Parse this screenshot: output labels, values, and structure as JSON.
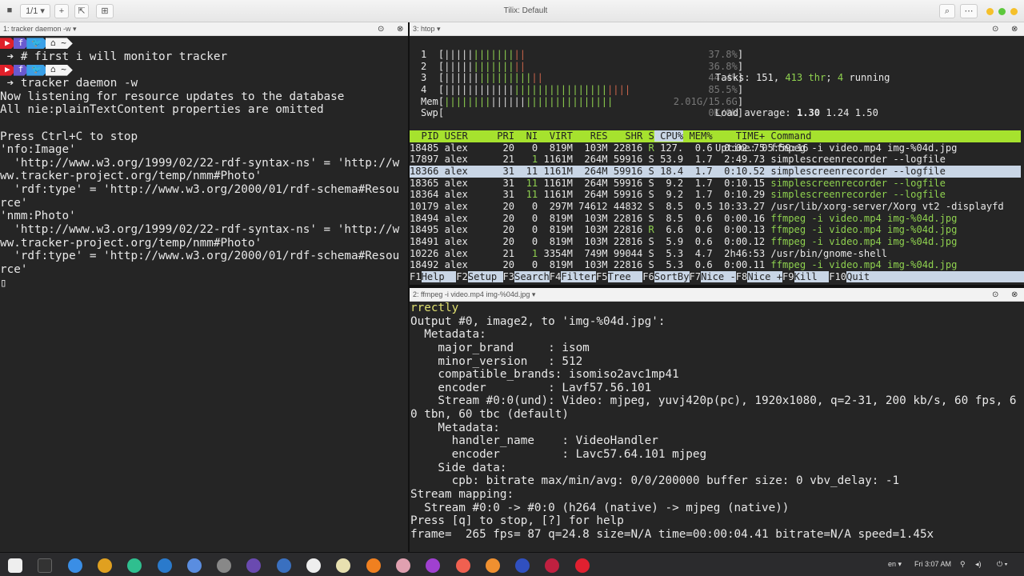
{
  "window": {
    "title": "Tilix: Default",
    "session": "1/1 ▾",
    "add": "+",
    "btn_detach": "⇱",
    "btn_new": "⊞",
    "search": "⌕",
    "menu": "⋯"
  },
  "panes": {
    "left": {
      "title": "1: tracker daemon -w ▾",
      "lines": [
        {
          "type": "prompt"
        },
        {
          "type": "cmd",
          "text": "# first i will monitor tracker"
        },
        {
          "type": "prompt"
        },
        {
          "type": "cmd",
          "text": "tracker daemon -w"
        },
        {
          "text": "Now listening for resource updates to the database"
        },
        {
          "text": "All nie:plainTextContent properties are omitted"
        },
        {
          "text": ""
        },
        {
          "text": "Press Ctrl+C to stop"
        },
        {
          "text": "'nfo:Image'"
        },
        {
          "text": "  'http://www.w3.org/1999/02/22-rdf-syntax-ns' = 'http://w"
        },
        {
          "text": "ww.tracker-project.org/temp/nmm#Photo'"
        },
        {
          "text": "  'rdf:type' = 'http://www.w3.org/2000/01/rdf-schema#Resou"
        },
        {
          "text": "rce'"
        },
        {
          "text": "'nmm:Photo'"
        },
        {
          "text": "  'http://www.w3.org/1999/02/22-rdf-syntax-ns' = 'http://w"
        },
        {
          "text": "ww.tracker-project.org/temp/nmm#Photo'"
        },
        {
          "text": "  'rdf:type' = 'http://www.w3.org/2000/01/rdf-schema#Resou"
        },
        {
          "text": "rce'"
        }
      ],
      "prompt_home": "~"
    },
    "htop": {
      "title": "3: htop ▾",
      "meters": [
        {
          "label": "1",
          "value": "37.8%",
          "fraction": 0.378
        },
        {
          "label": "2",
          "value": "36.8%",
          "fraction": 0.368
        },
        {
          "label": "3",
          "value": "44.4%",
          "fraction": 0.444
        },
        {
          "label": "4",
          "value": "85.5%",
          "fraction": 0.855
        },
        {
          "label": "Mem",
          "value": "2.01G/15.6G",
          "fraction": 0.75
        },
        {
          "label": "Swp",
          "value": "0K/0K",
          "fraction": 0
        }
      ],
      "tasks": "151",
      "threads": "413",
      "running": "4",
      "load": [
        "1.30",
        "1.24",
        "1.50"
      ],
      "uptime": "05:59:16",
      "columns": [
        "PID",
        "USER",
        "PRI",
        "NI",
        "VIRT",
        "RES",
        "SHR",
        "S",
        "CPU%",
        "MEM%",
        "TIME+",
        "Command"
      ],
      "rows": [
        [
          "18485",
          "alex",
          "20",
          "0",
          "819M",
          "103M",
          "22816",
          "R",
          "127.",
          "0.6",
          "0:02.75",
          "ffmpeg -i video.mp4 img-%04d.jpg"
        ],
        [
          "17897",
          "alex",
          "21",
          "1",
          "1161M",
          "264M",
          "59916",
          "S",
          "53.9",
          "1.7",
          "2:49.73",
          "simplescreenrecorder --logfile"
        ],
        [
          "18366",
          "alex",
          "31",
          "11",
          "1161M",
          "264M",
          "59916",
          "S",
          "18.4",
          "1.7",
          "0:10.52",
          "simplescreenrecorder --logfile"
        ],
        [
          "18365",
          "alex",
          "31",
          "11",
          "1161M",
          "264M",
          "59916",
          "S",
          "9.2",
          "1.7",
          "0:10.15",
          "simplescreenrecorder --logfile"
        ],
        [
          "18364",
          "alex",
          "31",
          "11",
          "1161M",
          "264M",
          "59916",
          "S",
          "9.2",
          "1.7",
          "0:10.29",
          "simplescreenrecorder --logfile"
        ],
        [
          "10179",
          "alex",
          "20",
          "0",
          "297M",
          "74612",
          "44832",
          "S",
          "8.5",
          "0.5",
          "10:33.27",
          "/usr/lib/xorg-server/Xorg vt2 -displayfd"
        ],
        [
          "18494",
          "alex",
          "20",
          "0",
          "819M",
          "103M",
          "22816",
          "S",
          "8.5",
          "0.6",
          "0:00.16",
          "ffmpeg -i video.mp4 img-%04d.jpg"
        ],
        [
          "18495",
          "alex",
          "20",
          "0",
          "819M",
          "103M",
          "22816",
          "R",
          "6.6",
          "0.6",
          "0:00.13",
          "ffmpeg -i video.mp4 img-%04d.jpg"
        ],
        [
          "18491",
          "alex",
          "20",
          "0",
          "819M",
          "103M",
          "22816",
          "S",
          "5.9",
          "0.6",
          "0:00.12",
          "ffmpeg -i video.mp4 img-%04d.jpg"
        ],
        [
          "10226",
          "alex",
          "21",
          "1",
          "3354M",
          "749M",
          "99044",
          "S",
          "5.3",
          "4.7",
          "2h46:53",
          "/usr/bin/gnome-shell"
        ],
        [
          "18492",
          "alex",
          "20",
          "0",
          "819M",
          "103M",
          "22816",
          "S",
          "5.3",
          "0.6",
          "0:00.11",
          "ffmpeg -i video.mp4 img-%04d.jpg"
        ]
      ],
      "thread_rows": [
        3,
        4,
        6,
        7,
        8,
        10
      ],
      "selected_row": 2,
      "fkeys": [
        [
          "F1",
          "Help  "
        ],
        [
          "F2",
          "Setup "
        ],
        [
          "F3",
          "Search"
        ],
        [
          "F4",
          "Filter"
        ],
        [
          "F5",
          "Tree  "
        ],
        [
          "F6",
          "SortBy"
        ],
        [
          "F7",
          "Nice -"
        ],
        [
          "F8",
          "Nice +"
        ],
        [
          "F9",
          "Kill  "
        ],
        [
          "F10",
          "Quit  "
        ]
      ]
    },
    "ffmpeg": {
      "title": "2: ffmpeg -i video.mp4 img-%04d.jpg ▾",
      "lines": [
        "rrectly",
        "Output #0, image2, to 'img-%04d.jpg':",
        "  Metadata:",
        "    major_brand     : isom",
        "    minor_version   : 512",
        "    compatible_brands: isomiso2avc1mp41",
        "    encoder         : Lavf57.56.101",
        "    Stream #0:0(und): Video: mjpeg, yuvj420p(pc), 1920x1080, q=2-31, 200 kb/s, 60 fps, 6",
        "0 tbn, 60 tbc (default)",
        "    Metadata:",
        "      handler_name    : VideoHandler",
        "      encoder         : Lavc57.64.101 mjpeg",
        "    Side data:",
        "      cpb: bitrate max/min/avg: 0/0/200000 buffer size: 0 vbv_delay: -1",
        "Stream mapping:",
        "  Stream #0:0 -> #0:0 (h264 (native) -> mjpeg (native))",
        "Press [q] to stop, [?] for help",
        "frame=  265 fps= 87 q=24.8 size=N/A time=00:00:04.41 bitrate=N/A speed=1.45x"
      ]
    }
  },
  "taskbar": {
    "lang": "en ▾",
    "clock": "Fri 3:07 AM",
    "apps": [
      {
        "name": "app-grid",
        "color": "#eeeeee"
      },
      {
        "name": "terminal",
        "color": "#333333"
      },
      {
        "name": "files",
        "color": "#3a8ee6"
      },
      {
        "name": "chrome",
        "color": "#e0a020"
      },
      {
        "name": "gitkraken",
        "color": "#2fbf8f"
      },
      {
        "name": "vscode",
        "color": "#2a7acc"
      },
      {
        "name": "chromium",
        "color": "#5a8de0"
      },
      {
        "name": "settings",
        "color": "#888888"
      },
      {
        "name": "app-3",
        "color": "#6a4ab0"
      },
      {
        "name": "app-blue",
        "color": "#3a70c0"
      },
      {
        "name": "obs",
        "color": "#eeeeee"
      },
      {
        "name": "text-editor",
        "color": "#e8e0b0"
      },
      {
        "name": "vlc",
        "color": "#f08020"
      },
      {
        "name": "app-dots",
        "color": "#e0a0b0"
      },
      {
        "name": "media-player",
        "color": "#a040d0"
      },
      {
        "name": "screenshot",
        "color": "#f06050"
      },
      {
        "name": "blender",
        "color": "#f09030"
      },
      {
        "name": "app-bluedots",
        "color": "#3050c0"
      },
      {
        "name": "app-heart",
        "color": "#c02040"
      },
      {
        "name": "recorder",
        "color": "#e02030"
      }
    ]
  }
}
